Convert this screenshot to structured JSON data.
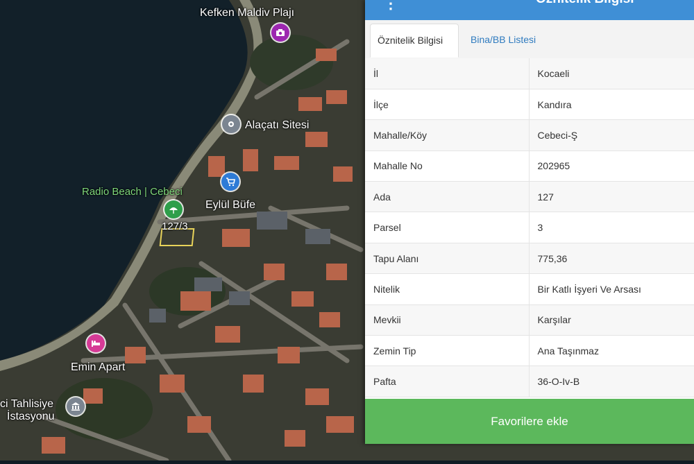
{
  "map": {
    "places": {
      "kefken": "Kefken Maldiv Plajı",
      "alacati": "Alaçatı Sitesi",
      "radio_beach": "Radio Beach | Cebeci",
      "eylul": "Eylül Büfe",
      "parcel": "127/3",
      "emin": "Emin Apart",
      "tahlisiye_1": "ci Tahlisiye",
      "tahlisiye_2": "İstasyonu"
    },
    "pins": {
      "kefken": {
        "icon": "camera-icon",
        "color": "#9c27b0"
      },
      "alacati": {
        "icon": "place-icon",
        "color": "#7b8591"
      },
      "eylul": {
        "icon": "shopping-cart-icon",
        "color": "#2e7bd6"
      },
      "radio_beach": {
        "icon": "beach-icon",
        "color": "#2e9e4a"
      },
      "emin": {
        "icon": "hotel-icon",
        "color": "#d63a96"
      },
      "tahlisiye": {
        "icon": "building-icon",
        "color": "#7b8591"
      }
    }
  },
  "panel": {
    "title": "Öznitelik Bilgisi",
    "menu_icon": "more-vert-icon",
    "tabs": [
      "Öznitelik Bilgisi",
      "Bina/BB Listesi"
    ],
    "rows": [
      {
        "key": "İl",
        "value": "Kocaeli"
      },
      {
        "key": "İlçe",
        "value": "Kandıra"
      },
      {
        "key": "Mahalle/Köy",
        "value": "Cebeci-Ş"
      },
      {
        "key": "Mahalle No",
        "value": "202965"
      },
      {
        "key": "Ada",
        "value": "127"
      },
      {
        "key": "Parsel",
        "value": "3"
      },
      {
        "key": "Tapu Alanı",
        "value": "775,36"
      },
      {
        "key": "Nitelik",
        "value": "Bir Katlı İşyeri Ve Arsası"
      },
      {
        "key": "Mevkii",
        "value": "Karşılar"
      },
      {
        "key": "Zemin Tip",
        "value": "Ana Taşınmaz"
      },
      {
        "key": "Pafta",
        "value": "36-O-Iv-B"
      }
    ],
    "favorite_button": "Favorilere ekle",
    "colors": {
      "header": "#3f8fd6",
      "favorite": "#5cb85c",
      "tab_link": "#2f7bbf"
    }
  }
}
